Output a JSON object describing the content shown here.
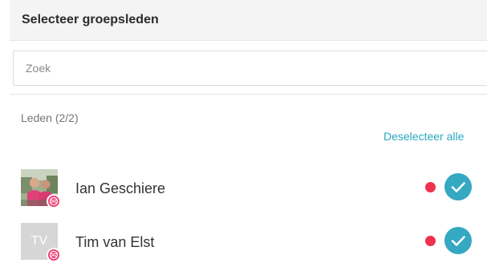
{
  "header": {
    "title": "Selecteer groepsleden"
  },
  "search": {
    "placeholder": "Zoek",
    "value": ""
  },
  "members": {
    "count_label": "Leden (2/2)",
    "deselect_all_label": "Deselecteer alle",
    "items": [
      {
        "name": "Ian Geschiere",
        "avatar": "photo",
        "avatar_icon": "profile-photo",
        "badge_icon": "dribbble-icon",
        "status_color": "#f0314c",
        "selected": true
      },
      {
        "name": "Tim van Elst",
        "avatar": "initials",
        "initials": "TV",
        "badge_icon": "dribbble-icon",
        "status_color": "#f0314c",
        "selected": true
      }
    ]
  },
  "colors": {
    "accent": "#35a8c2",
    "link": "#2aa7c0",
    "status_red": "#f0314c",
    "badge_pink": "#ee3b72"
  }
}
